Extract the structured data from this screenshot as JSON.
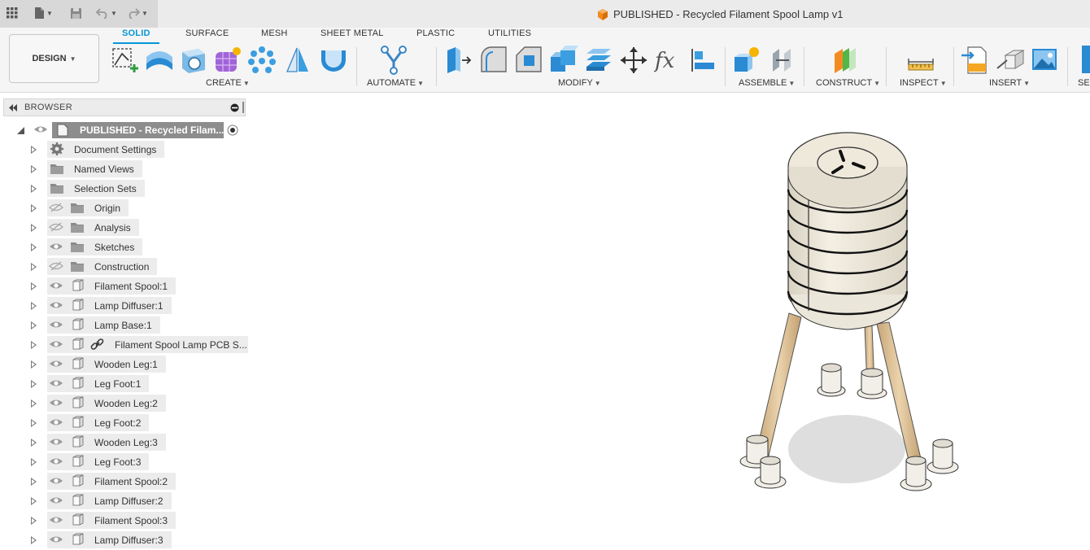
{
  "app": {
    "document_title": "PUBLISHED - Recycled Filament Spool Lamp v1",
    "design_label": "DESIGN",
    "icons": [
      "apps-grid-icon",
      "file-icon",
      "save-icon",
      "undo-icon",
      "redo-icon",
      "published-cube-icon"
    ]
  },
  "ribbon": {
    "tabs": [
      "SOLID",
      "SURFACE",
      "MESH",
      "SHEET METAL",
      "PLASTIC",
      "UTILITIES"
    ],
    "active_tab": "SOLID",
    "groups": {
      "create": "CREATE",
      "automate": "AUTOMATE",
      "modify": "MODIFY",
      "assemble": "ASSEMBLE",
      "construct": "CONSTRUCT",
      "inspect": "INSPECT",
      "insert": "INSERT",
      "select": "SEL"
    },
    "accent_color": "#0696d7"
  },
  "browser": {
    "title": "BROWSER",
    "root_label": "PUBLISHED - Recycled Filam...",
    "items": [
      {
        "label": "Document Settings",
        "icon": "gear-icon",
        "eye": "none"
      },
      {
        "label": "Named Views",
        "icon": "folder-icon",
        "eye": "none"
      },
      {
        "label": "Selection Sets",
        "icon": "folder-icon",
        "eye": "none"
      },
      {
        "label": "Origin",
        "icon": "folder-icon",
        "eye": "hidden"
      },
      {
        "label": "Analysis",
        "icon": "folder-icon",
        "eye": "hidden"
      },
      {
        "label": "Sketches",
        "icon": "folder-icon",
        "eye": "visible"
      },
      {
        "label": "Construction",
        "icon": "folder-icon",
        "eye": "hidden"
      },
      {
        "label": "Filament Spool:1",
        "icon": "component-icon",
        "eye": "visible"
      },
      {
        "label": "Lamp Diffuser:1",
        "icon": "component-icon",
        "eye": "visible"
      },
      {
        "label": "Lamp Base:1",
        "icon": "component-icon",
        "eye": "visible"
      },
      {
        "label": "Filament Spool Lamp PCB S...",
        "icon": "linked-component-icon",
        "eye": "visible"
      },
      {
        "label": "Wooden Leg:1",
        "icon": "component-icon",
        "eye": "visible"
      },
      {
        "label": "Leg Foot:1",
        "icon": "component-icon",
        "eye": "visible"
      },
      {
        "label": "Wooden Leg:2",
        "icon": "component-icon",
        "eye": "visible"
      },
      {
        "label": "Leg Foot:2",
        "icon": "component-icon",
        "eye": "visible"
      },
      {
        "label": "Wooden Leg:3",
        "icon": "component-icon",
        "eye": "visible"
      },
      {
        "label": "Leg Foot:3",
        "icon": "component-icon",
        "eye": "visible"
      },
      {
        "label": "Filament Spool:2",
        "icon": "component-icon",
        "eye": "visible"
      },
      {
        "label": "Lamp Diffuser:2",
        "icon": "component-icon",
        "eye": "visible"
      },
      {
        "label": "Filament Spool:3",
        "icon": "component-icon",
        "eye": "visible"
      },
      {
        "label": "Lamp Diffuser:3",
        "icon": "component-icon",
        "eye": "visible"
      }
    ]
  }
}
